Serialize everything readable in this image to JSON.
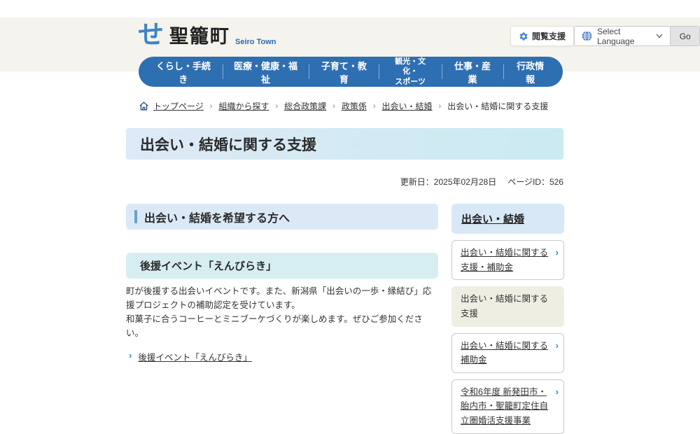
{
  "header": {
    "logo": {
      "mark": "せ",
      "title": "聖籠町",
      "subtitle": "Seiro Town"
    },
    "support_button_label": "閲覧支援",
    "language": {
      "label": "Select Language",
      "go_label": "Go"
    }
  },
  "nav": {
    "items": [
      {
        "label": "くらし・手続き"
      },
      {
        "label": "医療・健康・福祉"
      },
      {
        "label": "子育て・教育"
      },
      {
        "label": "観光・文化・\nスポーツ"
      },
      {
        "label": "仕事・産業"
      },
      {
        "label": "行政情報"
      }
    ]
  },
  "breadcrumb": {
    "items": [
      {
        "label": "トップページ"
      },
      {
        "label": "組織から探す"
      },
      {
        "label": "総合政策課"
      },
      {
        "label": "政策係"
      },
      {
        "label": "出会い・結婚"
      }
    ],
    "separator": "›",
    "current": "出会い・結婚に関する支援"
  },
  "page": {
    "title": "出会い・結婚に関する支援",
    "updated": "更新日：2025年02月28日",
    "page_id": "ページID：526"
  },
  "main": {
    "section_heading": "出会い・結婚を希望する方へ",
    "subsection_heading": "後援イベント「えんびらき」",
    "paragraph1": "町が後援する出会いイベントです。また、新潟県「出会いの一歩・縁結び」応援プロジェクトの補助認定を受けています。",
    "paragraph2": "和菓子に合うコーヒーとミニブーケづくりが楽しめます。ぜひご参加ください。",
    "link_chevron": "›",
    "link_label": "後援イベント「えんびらき」"
  },
  "sidebar": {
    "title": "出会い・結婚",
    "chevron": "›",
    "items": [
      {
        "label": "出会い・結婚に関する支援・補助金",
        "current": false
      },
      {
        "label": "出会い・結婚に関する支援",
        "current": true
      },
      {
        "label": "出会い・結婚に関する補助金",
        "current": false
      },
      {
        "label": "令和6年度 新発田市・胎内市・聖籠町定住自立圏婚活支援事業",
        "current": false
      }
    ]
  },
  "colors": {
    "nav_blue": "#2e6fb2",
    "accent_blue": "#2f88c7",
    "brand_blue": "#3c85c6",
    "header_cream": "#f5f3ed",
    "title_gradient_left": "#dde9f6",
    "title_gradient_right": "#cbeaf1",
    "section_bg": "#dbe9f7",
    "subsection_bg": "#d6eef2",
    "current_item_bg": "#efeee3"
  }
}
